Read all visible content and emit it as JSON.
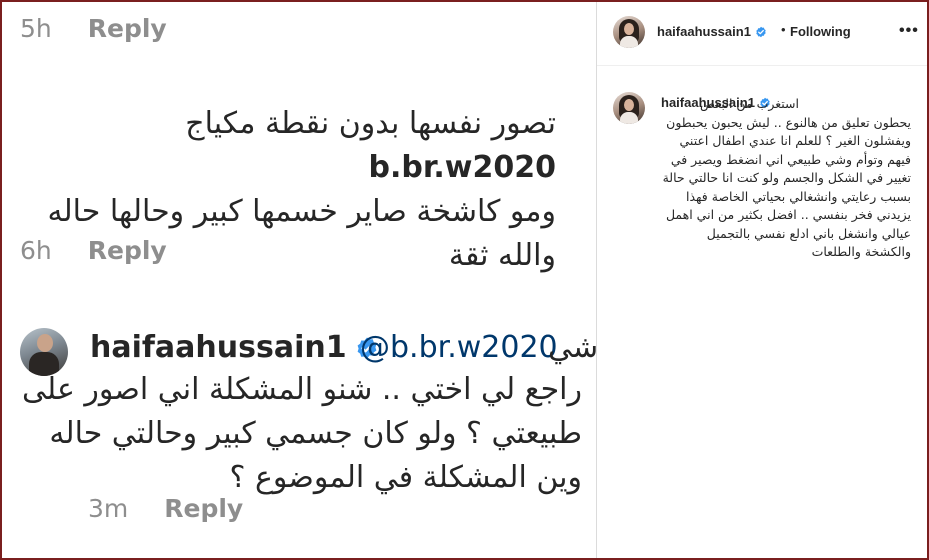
{
  "thread": {
    "comment1_prev_meta": {
      "time": "5h",
      "reply": "Reply"
    },
    "comment1": {
      "mention": "b.br.w2020",
      "text_a": "تصور نفسها بدون نقطة مكياج ",
      "text_b": "ومو كاشخة صاير خسمها كبير وحالها حاله والله ثقة"
    },
    "comment1_meta": {
      "time": "6h",
      "reply": "Reply"
    },
    "reply": {
      "username": "haifaahussain1",
      "mention": "@b.br.w2020",
      "lead": "شي",
      "text": "راجع لي اختي .. شنو المشكلة اني اصور على طبيعتي ؟ ولو كان جسمي كبير وحالتي حاله وين المشكلة في الموضوع ؟"
    },
    "reply_meta": {
      "time": "3m",
      "reply": "Reply"
    }
  },
  "post": {
    "header": {
      "username": "haifaahussain1",
      "dot": "•",
      "follow_label": "Following",
      "more_icon": "more-horizontal-icon"
    },
    "caption": {
      "username": "haifaahussain1",
      "text": "استغرب من البعض يحطون تعليق من هالنوع .. ليش يحبون يحبطون ويفشلون الغير ؟ للعلم انا عندي اطفال اعتني فيهم وتوأم وشي طبيعي اني انضغط ويصير في تغيير في الشكل والجسم ولو كنت انا حالتي حالة بسبب رعايتي وانشغالي بحياتي الخاصة فهذا يزيدني فخر بنفسي .. افضل بكثير من اني اهمل عيالي وانشغل باني ادلع نفسي بالتجميل والكشخة والطلعات"
    }
  },
  "colors": {
    "verified": "#3897f0",
    "meta_gray": "#8e8e8e",
    "mention_link": "#00376b",
    "frame_border": "#7a1f1f"
  }
}
